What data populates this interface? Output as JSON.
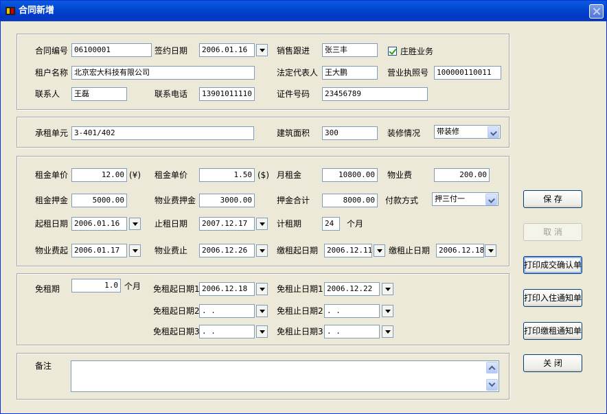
{
  "window": {
    "title": "合同新增",
    "icon": "app-icon"
  },
  "section1": {
    "contract_no_label": "合同编号",
    "contract_no": "06100001",
    "sign_date_label": "签约日期",
    "sign_date": "2006.01.16",
    "sales_label": "销售跟进",
    "sales": "张三丰",
    "zhuangsheng_label": "庄胜业务",
    "zhuangsheng_checked": true,
    "tenant_label": "租户名称",
    "tenant": "北京宏大科技有限公司",
    "legal_label": "法定代表人",
    "legal": "王大鹏",
    "license_label": "营业执照号",
    "license": "100000110011",
    "contact_label": "联系人",
    "contact": "王磊",
    "phone_label": "联系电话",
    "phone": "13901011110",
    "cert_label": "证件号码",
    "cert": "23456789"
  },
  "section2": {
    "unit_label": "承租单元",
    "unit": "3-401/402",
    "area_label": "建筑面积",
    "area": "300",
    "decor_label": "装修情况",
    "decor": "带装修"
  },
  "section3": {
    "rent_price_label": "租金单价",
    "rent_price": "12.00",
    "rent_unit": "(¥)",
    "rent_price2_label": "租金单价",
    "rent_price2": "1.50",
    "rent_unit2": "($)",
    "monthly_label": "月租金",
    "monthly": "10800.00",
    "property_fee_label": "物业费",
    "property_fee": "200.00",
    "deposit_label": "租金押金",
    "deposit": "5000.00",
    "prop_deposit_label": "物业费押金",
    "prop_deposit": "3000.00",
    "deposit_total_label": "押金合计",
    "deposit_total": "8000.00",
    "pay_method_label": "付款方式",
    "pay_method": "押三付一",
    "start_label": "起租日期",
    "start": "2006.01.16",
    "end_label": "止租日期",
    "end": "2007.12.17",
    "period_label": "计租期",
    "period": "24",
    "period_unit": "个月",
    "prop_start_label": "物业费起",
    "prop_start": "2006.01.17",
    "prop_end_label": "物业费止",
    "prop_end": "2006.12.26",
    "pay_start_label": "缴租起日期",
    "pay_start": "2006.12.11",
    "pay_end_label": "缴租止日期",
    "pay_end": "2006.12.18"
  },
  "section4": {
    "free_label": "免租期",
    "free": "1.0",
    "free_unit": "个月",
    "fs1_label": "免租起日期1",
    "fs1": "2006.12.18",
    "fe1_label": "免租止日期1",
    "fe1": "2006.12.22",
    "fs2_label": "免租起日期2",
    "fs2": "  .  .",
    "fe2_label": "免租止日期2",
    "fe2": "  .  .",
    "fs3_label": "免租起日期3",
    "fs3": "  .  .",
    "fe3_label": "免租止日期3",
    "fe3": "  .  ."
  },
  "section5": {
    "remark_label": "备注",
    "remark": ""
  },
  "buttons": {
    "save": "保  存",
    "cancel": "取  消",
    "print_confirm": "打印成交确认单",
    "print_checkin": "打印入住通知单",
    "print_payment": "打印缴租通知单",
    "close": "关  闭"
  }
}
